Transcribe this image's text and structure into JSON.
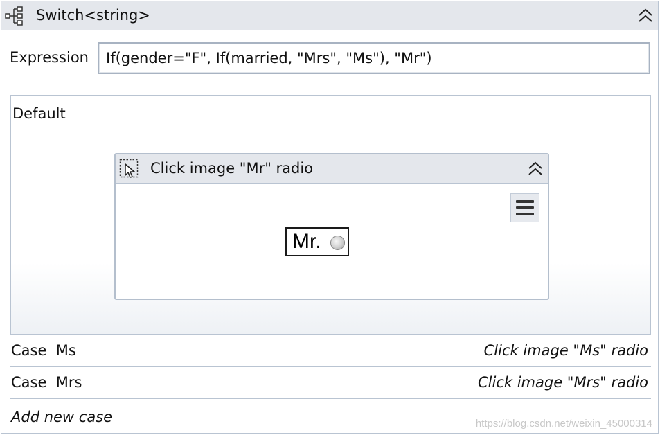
{
  "switch": {
    "title": "Switch<string>",
    "icon": "flowchart-switch-icon",
    "collapse_icon": "double-chevron-up-icon"
  },
  "expression": {
    "label": "Expression",
    "value": "If(gender=\"F\", If(married, \"Mrs\", \"Ms\"), \"Mr\")"
  },
  "default_case": {
    "label": "Default",
    "activity": {
      "title": "Click image \"Mr\" radio",
      "icon": "click-cursor-icon",
      "menu_icon": "hamburger-menu-icon",
      "captured_image_text": "Mr."
    }
  },
  "cases": [
    {
      "label": "Case  Ms",
      "action": "Click image \"Ms\" radio"
    },
    {
      "label": "Case  Mrs",
      "action": "Click image \"Mrs\" radio"
    }
  ],
  "add_case_label": "Add new case",
  "watermark": "https://blog.csdn.net/weixin_45000314"
}
